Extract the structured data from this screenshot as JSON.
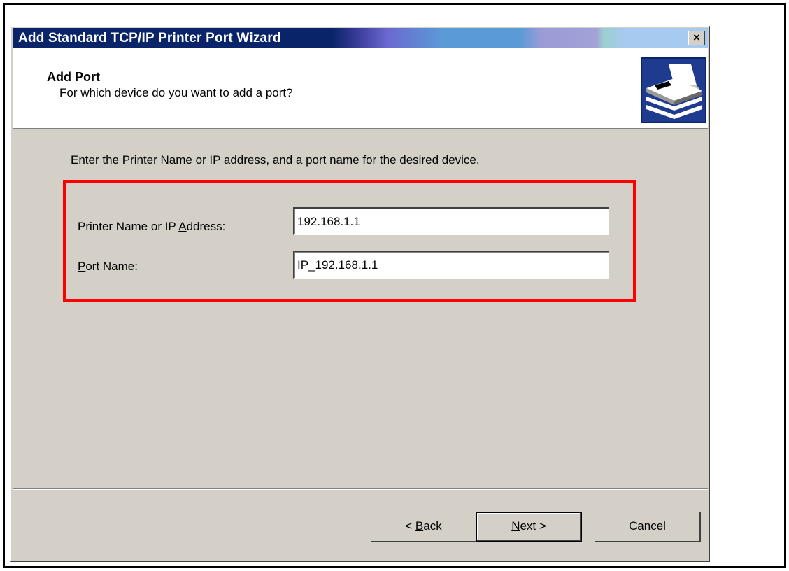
{
  "window": {
    "title": "Add Standard TCP/IP Printer Port Wizard",
    "close_label": "×"
  },
  "header": {
    "title": "Add Port",
    "subtitle": "For which device do you want to add a port?",
    "icon": "printer-port-wizard-icon"
  },
  "body": {
    "instructions": "Enter the Printer Name or IP address, and a port name for the desired device.",
    "fields": [
      {
        "label_pre": "Printer Name or IP ",
        "label_acc": "A",
        "label_post": "ddress:",
        "value": "192.168.1.1"
      },
      {
        "label_pre": "",
        "label_acc": "P",
        "label_post": "ort Name:",
        "value": "IP_192.168.1.1"
      }
    ]
  },
  "buttons": {
    "back": {
      "pre": "< ",
      "acc": "B",
      "post": "ack"
    },
    "next": {
      "pre": "",
      "acc": "N",
      "post": "ext >"
    },
    "cancel": {
      "label": "Cancel"
    }
  },
  "colors": {
    "title_gradient_start": "#0a246a",
    "dialog_face": "#d4d0c8",
    "highlight": "#ff0000"
  }
}
